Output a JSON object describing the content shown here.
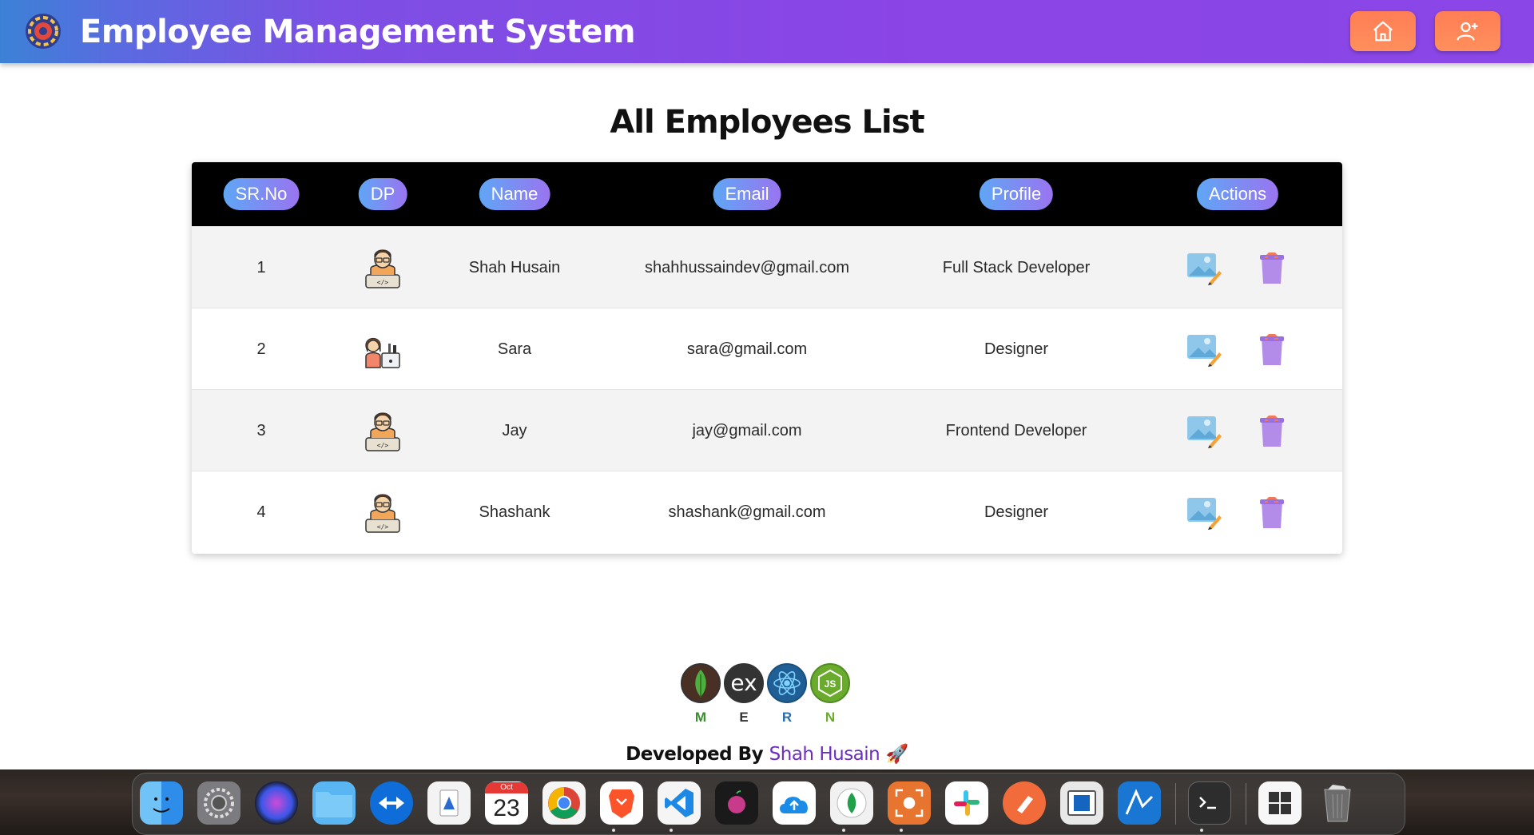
{
  "header": {
    "title": "Employee Management System",
    "home_button": "home-icon",
    "add_button": "add-user-icon"
  },
  "page_title": "All Employees List",
  "table": {
    "columns": [
      "SR.No",
      "DP",
      "Name",
      "Email",
      "Profile",
      "Actions"
    ],
    "rows": [
      {
        "sr": "1",
        "avatar": "male-developer",
        "name": "Shah Husain",
        "email": "shahhussaindev@gmail.com",
        "profile": "Full Stack Developer"
      },
      {
        "sr": "2",
        "avatar": "female-developer",
        "name": "Sara",
        "email": "sara@gmail.com",
        "profile": "Designer"
      },
      {
        "sr": "3",
        "avatar": "male-developer",
        "name": "Jay",
        "email": "jay@gmail.com",
        "profile": "Frontend Developer"
      },
      {
        "sr": "4",
        "avatar": "male-developer",
        "name": "Shashank",
        "email": "shashank@gmail.com",
        "profile": "Designer"
      }
    ],
    "actions": [
      "edit-icon",
      "delete-icon"
    ]
  },
  "footer": {
    "stack": [
      {
        "letter": "M",
        "icon": "mongodb-icon",
        "color": "#3a8a2e"
      },
      {
        "letter": "E",
        "icon": "express-icon",
        "color": "#333333"
      },
      {
        "letter": "R",
        "icon": "react-icon",
        "color": "#2a6fa8"
      },
      {
        "letter": "N",
        "icon": "nodejs-icon",
        "color": "#6aab2e"
      }
    ],
    "express_text": "ex",
    "developed_by": "Developed By",
    "author": "Shah Husain",
    "rocket": "🚀"
  },
  "dock": {
    "calendar_month": "Oct",
    "calendar_day": "23",
    "apps": [
      "finder",
      "system-preferences",
      "siri",
      "files",
      "teamviewer",
      "preview",
      "calendar",
      "chrome",
      "brave",
      "vscode",
      "apple-tv",
      "cloud-upload",
      "mongodb-compass",
      "screenshot",
      "slack",
      "paw",
      "virtualbox",
      "testflight",
      "terminal",
      "windows",
      "trash"
    ]
  },
  "colors": {
    "accent": "#8b44e6",
    "header_button": "#ff7e55",
    "pill_start": "#5fa6f5",
    "pill_end": "#9a74f0",
    "author": "#6b2fc0"
  }
}
